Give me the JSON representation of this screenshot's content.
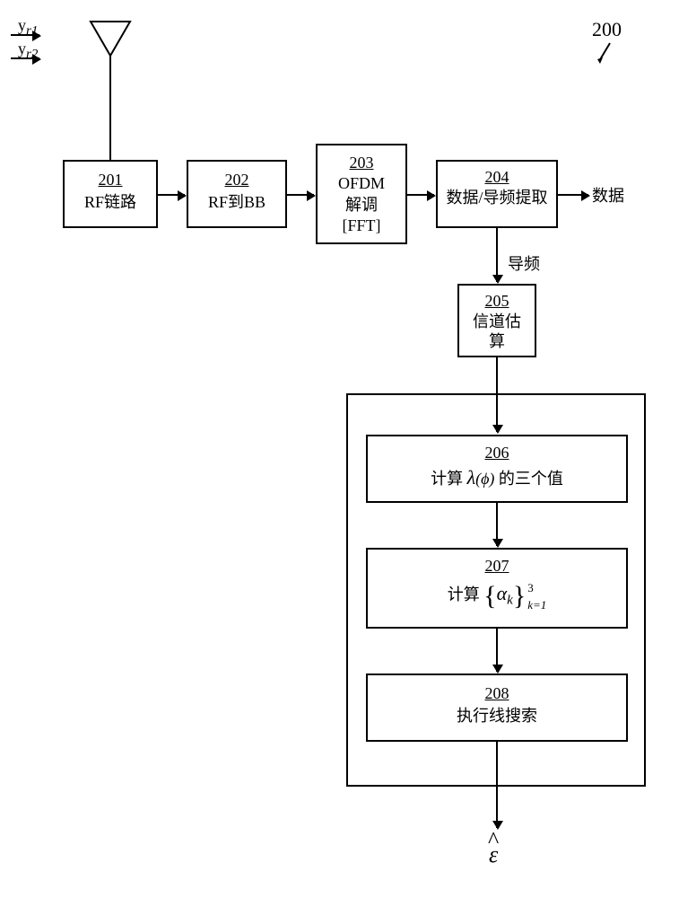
{
  "figure_ref": "200",
  "inputs": {
    "y1": "y",
    "r1": "r1",
    "y2": "y",
    "r2": "r2"
  },
  "blocks": {
    "b201": {
      "ref": "201",
      "label": "RF链路"
    },
    "b202": {
      "ref": "202",
      "label": "RF到BB"
    },
    "b203": {
      "ref": "203",
      "line1": "OFDM",
      "line2": "解调",
      "line3": "[FFT]"
    },
    "b204": {
      "ref": "204",
      "label": "数据/导频提取"
    },
    "b205": {
      "ref": "205",
      "line1": "信道估",
      "line2": "算"
    },
    "b206": {
      "ref": "206",
      "prefix": "计算",
      "lambda": "λ",
      "arg": "(ϕ)",
      "suffix": " 的三个值"
    },
    "b207": {
      "ref": "207",
      "prefix": "计算",
      "alpha": "α",
      "sub": "k",
      "lb": "{",
      "rb": "}",
      "sup": "3",
      "klabel": "k=1"
    },
    "b208": {
      "ref": "208",
      "label": "执行线搜索"
    }
  },
  "side_labels": {
    "data_out": "数据",
    "pilot": "导频"
  },
  "output": {
    "hat": "^",
    "eps": "ε"
  }
}
